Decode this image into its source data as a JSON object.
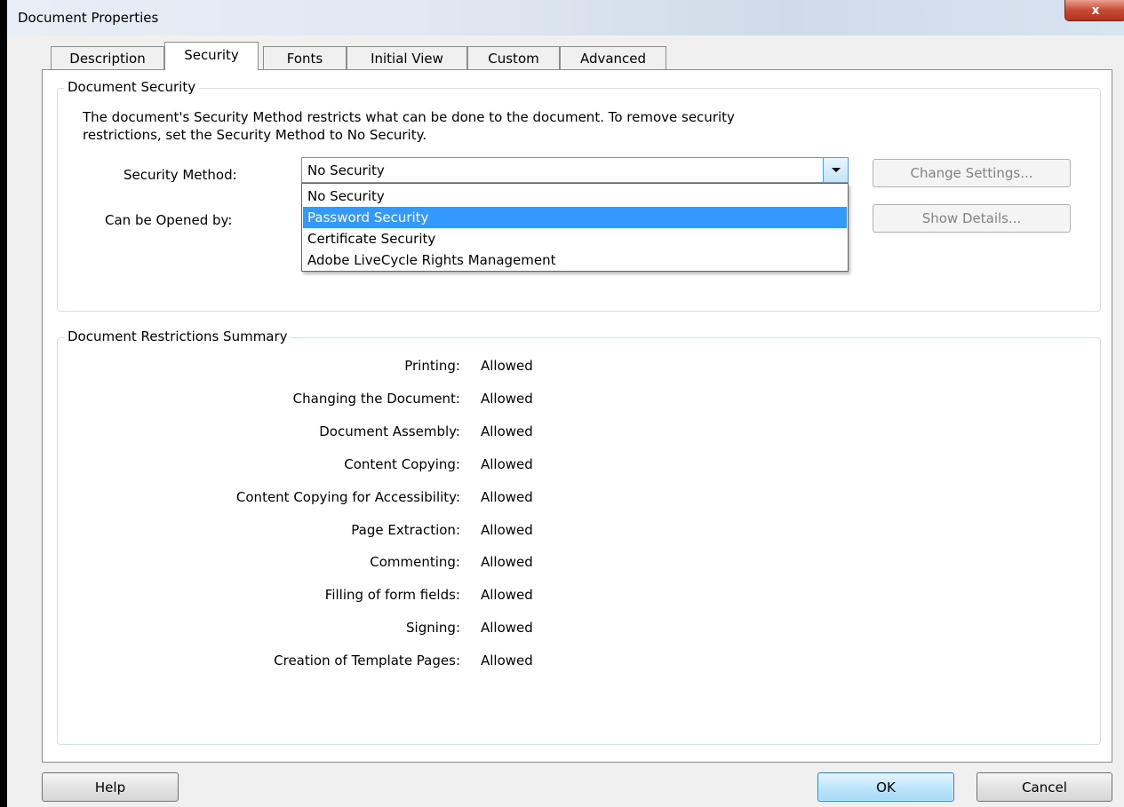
{
  "window": {
    "title": "Document Properties",
    "close_label": "x"
  },
  "tabs": [
    {
      "label": "Description"
    },
    {
      "label": "Security"
    },
    {
      "label": "Fonts"
    },
    {
      "label": "Initial View"
    },
    {
      "label": "Custom"
    },
    {
      "label": "Advanced"
    }
  ],
  "active_tab": "Security",
  "document_security": {
    "title": "Document Security",
    "description_line1": "The document's Security Method restricts what can be done to the document. To remove security",
    "description_line2": "restrictions, set the Security Method to No Security.",
    "security_method_label": "Security Method:",
    "security_method_value": "No Security",
    "can_be_opened_label": "Can be Opened by:",
    "change_settings_label": "Change Settings...",
    "show_details_label": "Show Details...",
    "dropdown_options": [
      {
        "label": "No Security",
        "highlighted": false
      },
      {
        "label": "Password Security",
        "highlighted": true
      },
      {
        "label": "Certificate Security",
        "highlighted": false
      },
      {
        "label": "Adobe LiveCycle Rights Management",
        "highlighted": false
      }
    ]
  },
  "restrictions": {
    "title": "Document Restrictions Summary",
    "rows": [
      {
        "label": "Printing:",
        "value": "Allowed"
      },
      {
        "label": "Changing the Document:",
        "value": "Allowed"
      },
      {
        "label": "Document Assembly:",
        "value": "Allowed"
      },
      {
        "label": "Content Copying:",
        "value": "Allowed"
      },
      {
        "label": "Content Copying for Accessibility:",
        "value": "Allowed"
      },
      {
        "label": "Page Extraction:",
        "value": "Allowed"
      },
      {
        "label": "Commenting:",
        "value": "Allowed"
      },
      {
        "label": "Filling of form fields:",
        "value": "Allowed"
      },
      {
        "label": "Signing:",
        "value": "Allowed"
      },
      {
        "label": "Creation of Template Pages:",
        "value": "Allowed"
      }
    ]
  },
  "footer": {
    "help_label": "Help",
    "ok_label": "OK",
    "cancel_label": "Cancel"
  },
  "colors": {
    "highlight": "#3399ff",
    "accent_border": "#569de5",
    "close_red": "#c84a32"
  }
}
